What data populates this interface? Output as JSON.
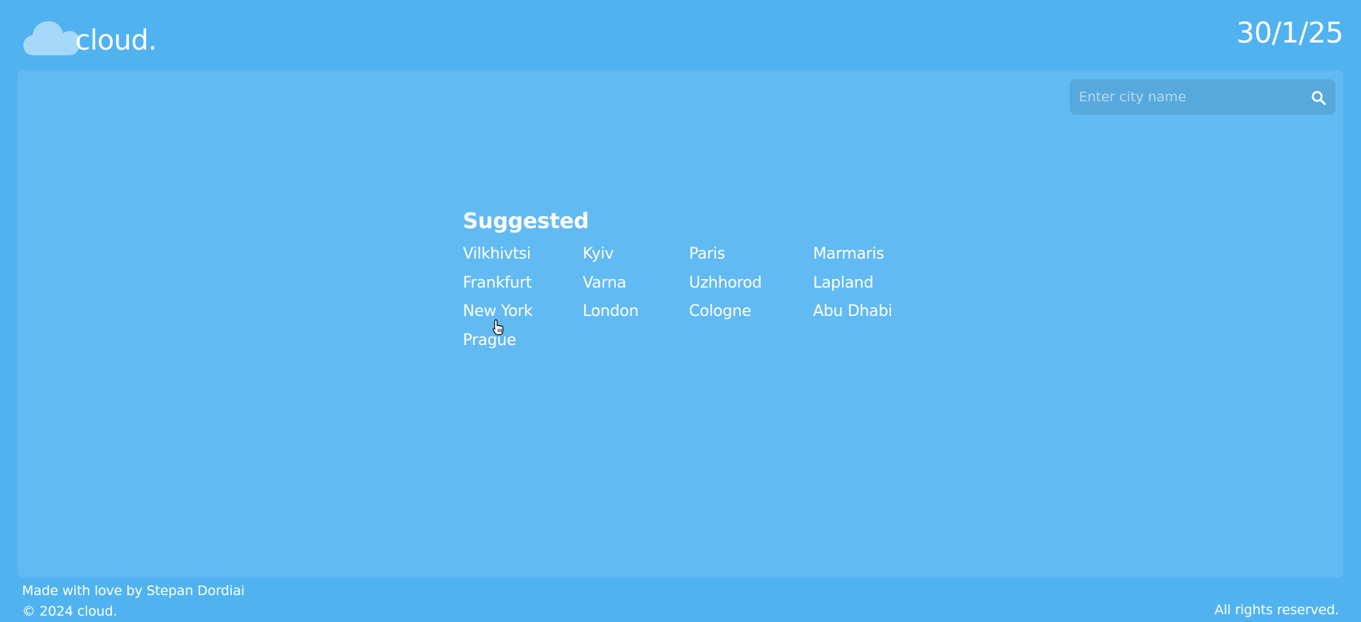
{
  "brand": {
    "name": "cloud.",
    "icon": "cloud-icon"
  },
  "date": "30/1/25",
  "search": {
    "placeholder": "Enter city name",
    "value": "",
    "icon": "search-icon"
  },
  "suggested": {
    "title": "Suggested",
    "cities": [
      "Vilkhivtsi",
      "Kyiv",
      "Paris",
      "Marmaris",
      "Frankfurt",
      "Varna",
      "Uzhhorod",
      "Lapland",
      "New York",
      "London",
      "Cologne",
      "Abu Dhabi",
      "Prague"
    ]
  },
  "footer": {
    "credit": "Made with love by Stepan Dordiai",
    "copyright": "© 2024 cloud.",
    "rights": "All rights reserved."
  },
  "colors": {
    "background": "#50b3f0",
    "panel": "#62baf3",
    "search_bg": "#57a9dd",
    "text": "#ffffff"
  }
}
